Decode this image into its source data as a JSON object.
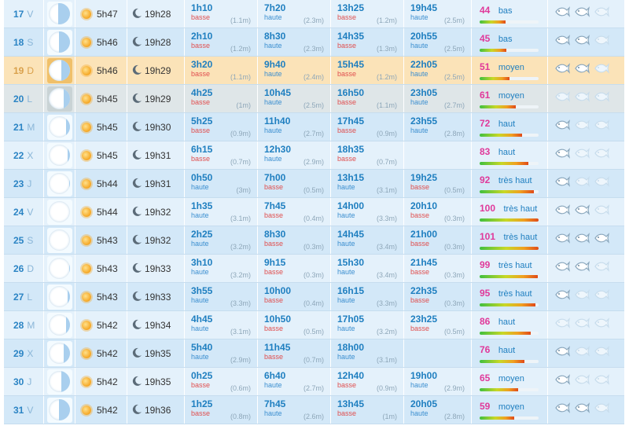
{
  "rows": [
    {
      "day_num": "17",
      "day_letter": "V",
      "sunrise": "5h47",
      "moonset": "19h28",
      "tides": [
        {
          "time": "1h10",
          "type": "basse",
          "height": "(1.1m)"
        },
        {
          "time": "7h20",
          "type": "haute",
          "height": "(2.3m)"
        },
        {
          "time": "13h25",
          "type": "basse",
          "height": "(1.2m)"
        },
        {
          "time": "19h45",
          "type": "haute",
          "height": "(2.5m)"
        }
      ],
      "coef": "44",
      "coef_word": "bas",
      "coef_level": 0.44,
      "fish_active": 2,
      "phase": 0.55,
      "bg": "odd"
    },
    {
      "day_num": "18",
      "day_letter": "S",
      "sunrise": "5h46",
      "moonset": "19h28",
      "tides": [
        {
          "time": "2h10",
          "type": "basse",
          "height": "(1.2m)"
        },
        {
          "time": "8h30",
          "type": "haute",
          "height": "(2.3m)"
        },
        {
          "time": "14h35",
          "type": "basse",
          "height": "(1.3m)"
        },
        {
          "time": "20h55",
          "type": "haute",
          "height": "(2.5m)"
        }
      ],
      "coef": "45",
      "coef_word": "bas",
      "coef_level": 0.45,
      "fish_active": 2,
      "phase": 0.5,
      "bg": "even"
    },
    {
      "day_num": "19",
      "day_letter": "D",
      "sunrise": "5h46",
      "moonset": "19h29",
      "tides": [
        {
          "time": "3h20",
          "type": "basse",
          "height": "(1.1m)"
        },
        {
          "time": "9h40",
          "type": "haute",
          "height": "(2.4m)"
        },
        {
          "time": "15h45",
          "type": "basse",
          "height": "(1.2m)"
        },
        {
          "time": "22h05",
          "type": "haute",
          "height": "(2.5m)"
        }
      ],
      "coef": "51",
      "coef_word": "moyen",
      "coef_level": 0.51,
      "fish_active": 2,
      "phase": 0.4,
      "bg": "today"
    },
    {
      "day_num": "20",
      "day_letter": "L",
      "sunrise": "5h45",
      "moonset": "19h29",
      "tides": [
        {
          "time": "4h25",
          "type": "basse",
          "height": "(1m)"
        },
        {
          "time": "10h45",
          "type": "haute",
          "height": "(2.5m)"
        },
        {
          "time": "16h50",
          "type": "basse",
          "height": "(1.1m)"
        },
        {
          "time": "23h05",
          "type": "haute",
          "height": "(2.7m)"
        }
      ],
      "coef": "61",
      "coef_word": "moyen",
      "coef_level": 0.61,
      "fish_active": 0,
      "phase": 0.3,
      "bg": "grey"
    },
    {
      "day_num": "21",
      "day_letter": "M",
      "sunrise": "5h45",
      "moonset": "19h30",
      "tides": [
        {
          "time": "5h25",
          "type": "basse",
          "height": "(0.9m)"
        },
        {
          "time": "11h40",
          "type": "haute",
          "height": "(2.7m)"
        },
        {
          "time": "17h45",
          "type": "basse",
          "height": "(0.9m)"
        },
        {
          "time": "23h55",
          "type": "haute",
          "height": "(2.8m)"
        }
      ],
      "coef": "72",
      "coef_word": "haut",
      "coef_level": 0.72,
      "fish_active": 1,
      "phase": 0.2,
      "bg": "even"
    },
    {
      "day_num": "22",
      "day_letter": "X",
      "sunrise": "5h45",
      "moonset": "19h31",
      "tides": [
        {
          "time": "6h15",
          "type": "basse",
          "height": "(0.7m)"
        },
        {
          "time": "12h30",
          "type": "haute",
          "height": "(2.9m)"
        },
        {
          "time": "18h35",
          "type": "basse",
          "height": "(0.7m)"
        },
        {
          "time": "",
          "type": "",
          "height": ""
        }
      ],
      "coef": "83",
      "coef_word": "haut",
      "coef_level": 0.83,
      "fish_active": 1,
      "phase": 0.1,
      "bg": "odd"
    },
    {
      "day_num": "23",
      "day_letter": "J",
      "sunrise": "5h44",
      "moonset": "19h31",
      "tides": [
        {
          "time": "0h50",
          "type": "haute",
          "height": "(3m)"
        },
        {
          "time": "7h00",
          "type": "basse",
          "height": "(0.5m)"
        },
        {
          "time": "13h15",
          "type": "haute",
          "height": "(3.1m)"
        },
        {
          "time": "19h25",
          "type": "basse",
          "height": "(0.5m)"
        }
      ],
      "coef": "92",
      "coef_word": "très haut",
      "coef_level": 0.92,
      "fish_active": 1,
      "phase": 0.05,
      "bg": "even"
    },
    {
      "day_num": "24",
      "day_letter": "V",
      "sunrise": "5h44",
      "moonset": "19h32",
      "tides": [
        {
          "time": "1h35",
          "type": "haute",
          "height": "(3.1m)"
        },
        {
          "time": "7h45",
          "type": "basse",
          "height": "(0.4m)"
        },
        {
          "time": "14h00",
          "type": "haute",
          "height": "(3.3m)"
        },
        {
          "time": "20h10",
          "type": "basse",
          "height": "(0.3m)"
        }
      ],
      "coef": "100",
      "coef_word": "très haut",
      "coef_level": 1.0,
      "fish_active": 2,
      "phase": 0.0,
      "bg": "odd"
    },
    {
      "day_num": "25",
      "day_letter": "S",
      "sunrise": "5h43",
      "moonset": "19h32",
      "tides": [
        {
          "time": "2h25",
          "type": "haute",
          "height": "(3.2m)"
        },
        {
          "time": "8h30",
          "type": "basse",
          "height": "(0.3m)"
        },
        {
          "time": "14h45",
          "type": "haute",
          "height": "(3.4m)"
        },
        {
          "time": "21h00",
          "type": "basse",
          "height": "(0.3m)"
        }
      ],
      "coef": "101",
      "coef_word": "très haut",
      "coef_level": 1.0,
      "fish_active": 3,
      "phase": 0.0,
      "bg": "even"
    },
    {
      "day_num": "26",
      "day_letter": "D",
      "sunrise": "5h43",
      "moonset": "19h33",
      "tides": [
        {
          "time": "3h10",
          "type": "haute",
          "height": "(3.2m)"
        },
        {
          "time": "9h15",
          "type": "basse",
          "height": "(0.3m)"
        },
        {
          "time": "15h30",
          "type": "haute",
          "height": "(3.4m)"
        },
        {
          "time": "21h45",
          "type": "basse",
          "height": "(0.3m)"
        }
      ],
      "coef": "99",
      "coef_word": "très haut",
      "coef_level": 0.99,
      "fish_active": 2,
      "phase": 0.05,
      "bg": "odd"
    },
    {
      "day_num": "27",
      "day_letter": "L",
      "sunrise": "5h43",
      "moonset": "19h33",
      "tides": [
        {
          "time": "3h55",
          "type": "haute",
          "height": "(3.3m)"
        },
        {
          "time": "10h00",
          "type": "basse",
          "height": "(0.4m)"
        },
        {
          "time": "16h15",
          "type": "haute",
          "height": "(3.3m)"
        },
        {
          "time": "22h35",
          "type": "basse",
          "height": "(0.3m)"
        }
      ],
      "coef": "95",
      "coef_word": "très haut",
      "coef_level": 0.95,
      "fish_active": 1,
      "phase": 0.1,
      "bg": "even"
    },
    {
      "day_num": "28",
      "day_letter": "M",
      "sunrise": "5h42",
      "moonset": "19h34",
      "tides": [
        {
          "time": "4h45",
          "type": "haute",
          "height": "(3.1m)"
        },
        {
          "time": "10h50",
          "type": "basse",
          "height": "(0.5m)"
        },
        {
          "time": "17h05",
          "type": "haute",
          "height": "(3.2m)"
        },
        {
          "time": "23h25",
          "type": "basse",
          "height": "(0.5m)"
        }
      ],
      "coef": "86",
      "coef_word": "haut",
      "coef_level": 0.86,
      "fish_active": 0,
      "phase": 0.2,
      "bg": "odd"
    },
    {
      "day_num": "29",
      "day_letter": "X",
      "sunrise": "5h42",
      "moonset": "19h35",
      "tides": [
        {
          "time": "5h40",
          "type": "haute",
          "height": "(2.9m)"
        },
        {
          "time": "11h45",
          "type": "basse",
          "height": "(0.7m)"
        },
        {
          "time": "18h00",
          "type": "haute",
          "height": "(3.1m)"
        },
        {
          "time": "",
          "type": "",
          "height": ""
        }
      ],
      "coef": "76",
      "coef_word": "haut",
      "coef_level": 0.76,
      "fish_active": 1,
      "phase": 0.3,
      "bg": "even"
    },
    {
      "day_num": "30",
      "day_letter": "J",
      "sunrise": "5h42",
      "moonset": "19h35",
      "tides": [
        {
          "time": "0h25",
          "type": "basse",
          "height": "(0.6m)"
        },
        {
          "time": "6h40",
          "type": "haute",
          "height": "(2.7m)"
        },
        {
          "time": "12h40",
          "type": "basse",
          "height": "(0.9m)"
        },
        {
          "time": "19h00",
          "type": "haute",
          "height": "(2.9m)"
        }
      ],
      "coef": "65",
      "coef_word": "moyen",
      "coef_level": 0.65,
      "fish_active": 1,
      "phase": 0.4,
      "bg": "odd"
    },
    {
      "day_num": "31",
      "day_letter": "V",
      "sunrise": "5h42",
      "moonset": "19h36",
      "tides": [
        {
          "time": "1h25",
          "type": "basse",
          "height": "(0.8m)"
        },
        {
          "time": "7h45",
          "type": "haute",
          "height": "(2.6m)"
        },
        {
          "time": "13h45",
          "type": "basse",
          "height": "(1m)"
        },
        {
          "time": "20h05",
          "type": "haute",
          "height": "(2.8m)"
        }
      ],
      "coef": "59",
      "coef_word": "moyen",
      "coef_level": 0.59,
      "fish_active": 2,
      "phase": 0.5,
      "bg": "even"
    }
  ],
  "colors": {
    "row_even": "#d3e8f8",
    "row_odd": "#e4f1fb",
    "row_today": "#fbe3b8",
    "coef_value": "#e0399a",
    "tide_time": "#1f7fc0",
    "basse": "#e05050",
    "haute": "#3c8fd0"
  },
  "icons": {
    "sunrise": "sun-icon",
    "moonset": "crescent-moon-icon",
    "fishing": "fish-icon"
  }
}
